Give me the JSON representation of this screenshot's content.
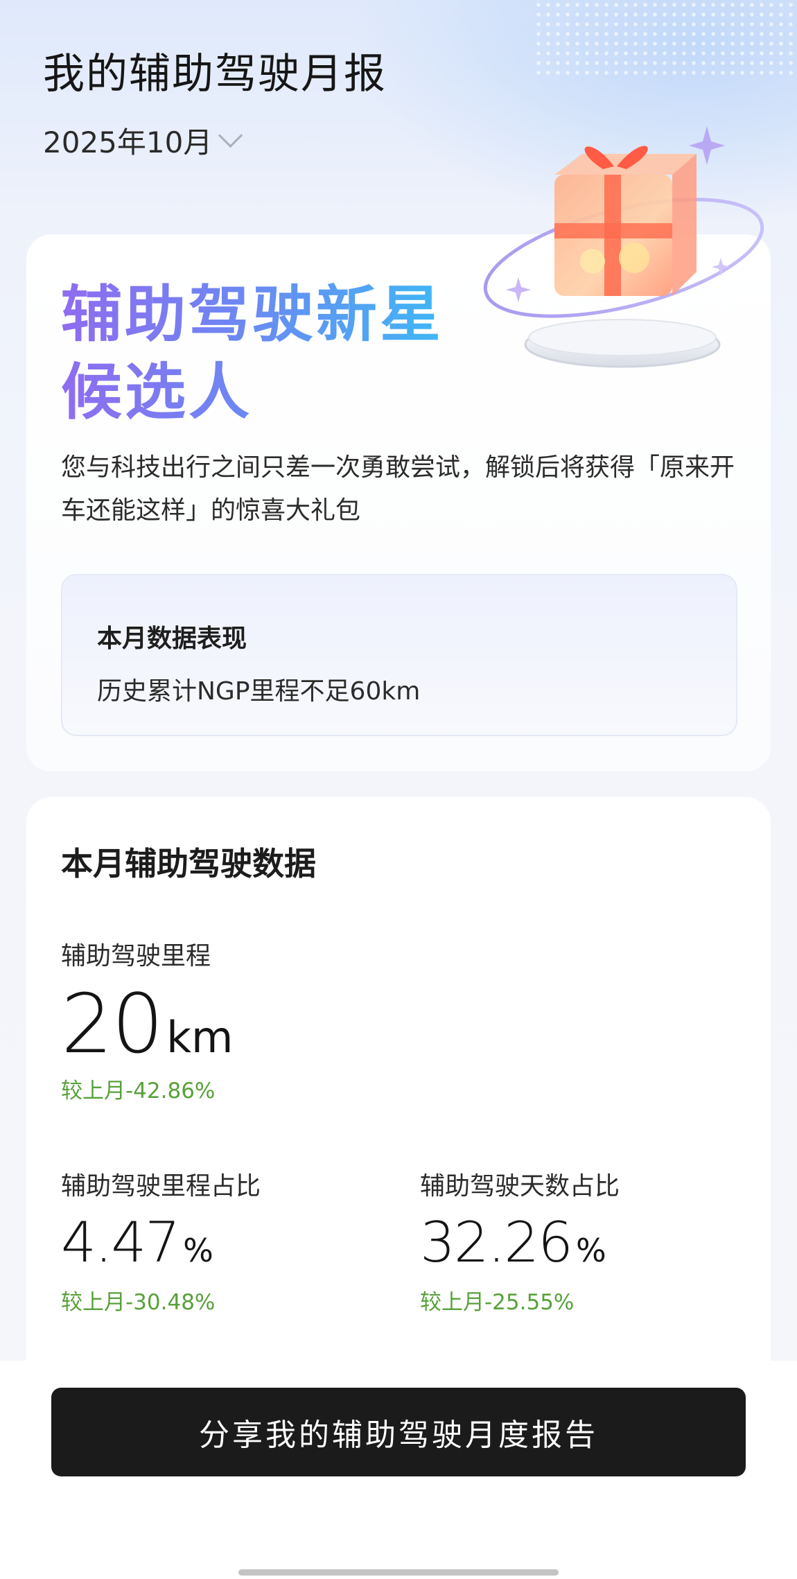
{
  "header": {
    "title": "我的辅助驾驶月报",
    "month": "2025年10月"
  },
  "status_card": {
    "hero_line1": "辅助驾驶新星",
    "hero_line2": "候选人",
    "description": "您与科技出行之间只差一次勇敢尝试，解锁后将获得「原来开车还能这样」的惊喜大礼包",
    "performance": {
      "title": "本月数据表现",
      "text": "历史累计NGP里程不足60km"
    },
    "gift_icon": "gift-box-icon"
  },
  "data_card": {
    "title": "本月辅助驾驶数据",
    "metrics": [
      {
        "label": "辅助驾驶里程",
        "value": "20",
        "unit": "km",
        "compare": "较上月-42.86%"
      },
      {
        "label": "辅助驾驶里程占比",
        "value": "4.47",
        "unit": "%",
        "compare": "较上月-30.48%"
      },
      {
        "label": "辅助驾驶天数占比",
        "value": "32.26",
        "unit": "%",
        "compare": "较上月-25.55%"
      }
    ]
  },
  "share_button": "分享我的辅助驾驶月度报告",
  "colors": {
    "hero_gradient_start": "#8f6cf0",
    "hero_gradient_end": "#3fb7f4",
    "compare_green": "#58a13a",
    "button_bg": "#1b1b1b"
  }
}
